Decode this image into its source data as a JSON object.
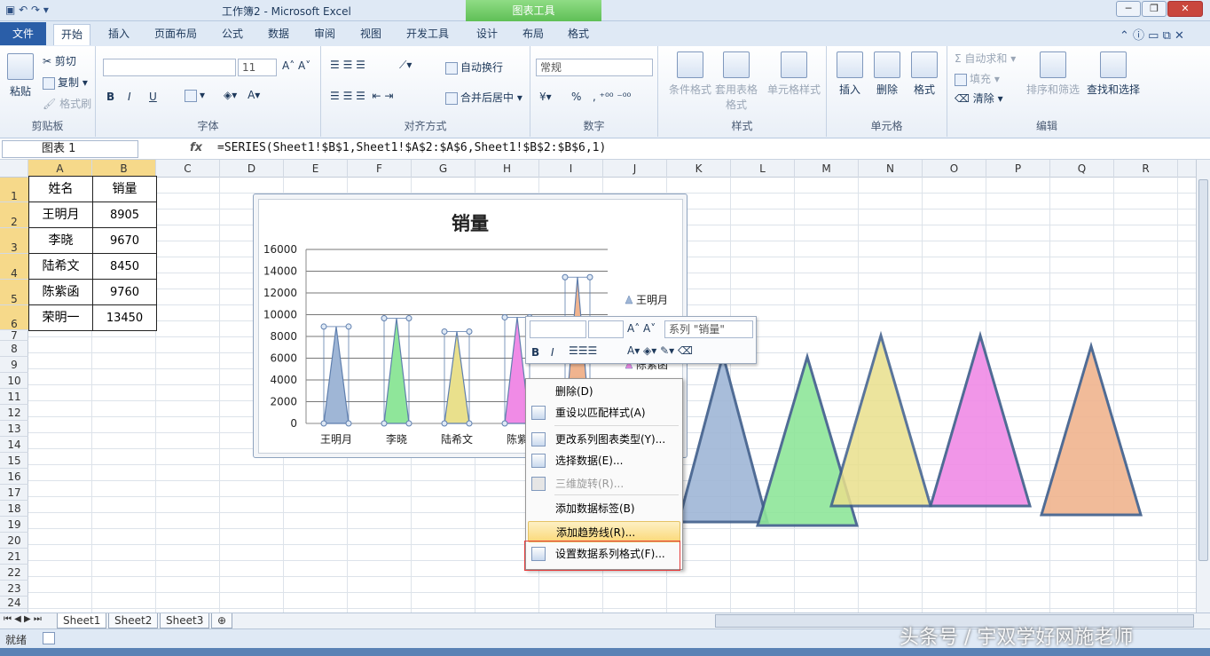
{
  "window": {
    "title": "工作簿2 - Microsoft Excel",
    "chart_tools": "图表工具",
    "minimize": "─",
    "restore": "❐",
    "close": "✕"
  },
  "tabs": [
    "文件",
    "开始",
    "插入",
    "页面布局",
    "公式",
    "数据",
    "审阅",
    "视图",
    "开发工具",
    "设计",
    "布局",
    "格式"
  ],
  "ribbon": {
    "clipboard": {
      "label": "剪贴板",
      "paste": "粘贴",
      "cut": "剪切",
      "copy": "复制",
      "format_painter": "格式刷"
    },
    "font": {
      "label": "字体",
      "size": "11",
      "bold": "B",
      "italic": "I",
      "underline": "U"
    },
    "alignment": {
      "label": "对齐方式",
      "wrap": "自动换行",
      "merge": "合并后居中"
    },
    "number": {
      "label": "数字",
      "format": "常规",
      "percent": "%"
    },
    "styles": {
      "label": "样式",
      "conditional": "条件格式",
      "table": "套用表格格式",
      "cell": "单元格样式"
    },
    "cells": {
      "label": "单元格",
      "insert": "插入",
      "delete": "删除",
      "format": "格式"
    },
    "editing": {
      "label": "编辑",
      "autosum": "自动求和",
      "fill": "填充",
      "clear": "清除",
      "sort": "排序和筛选",
      "find": "查找和选择"
    }
  },
  "formula_bar": {
    "name_box": "图表 1",
    "fx": "fx",
    "formula": "=SERIES(Sheet1!$B$1,Sheet1!$A$2:$A$6,Sheet1!$B$2:$B$6,1)"
  },
  "columns": [
    "A",
    "B",
    "C",
    "D",
    "E",
    "F",
    "G",
    "H",
    "I",
    "J",
    "K",
    "L",
    "M",
    "N",
    "O",
    "P",
    "Q",
    "R"
  ],
  "rows": [
    "1",
    "2",
    "3",
    "4",
    "5",
    "6",
    "7",
    "8",
    "9",
    "10",
    "11",
    "12",
    "13",
    "14",
    "15",
    "16",
    "17",
    "18",
    "19",
    "20",
    "21",
    "22",
    "23",
    "24"
  ],
  "table": {
    "headers": [
      "姓名",
      "销量"
    ],
    "rows": [
      [
        "王明月",
        "8905"
      ],
      [
        "李晓",
        "9670"
      ],
      [
        "陆希文",
        "8450"
      ],
      [
        "陈紫函",
        "9760"
      ],
      [
        "荣明一",
        "13450"
      ]
    ]
  },
  "chart_data": {
    "type": "bar",
    "title": "销量",
    "categories": [
      "王明月",
      "李晓",
      "陆希文",
      "陈紫"
    ],
    "values": [
      8905,
      9670,
      8450,
      9760,
      13450
    ],
    "ylim": [
      0,
      16000
    ],
    "yticks": [
      "0",
      "2000",
      "4000",
      "6000",
      "8000",
      "10000",
      "12000",
      "14000",
      "16000"
    ],
    "legend": [
      "王明月",
      "陈紫函"
    ],
    "colors": [
      "#9fb6d6",
      "#8fe69a",
      "#e9e08c",
      "#f08be6",
      "#f0b48f"
    ],
    "grid": true
  },
  "mini_toolbar": {
    "series_selector": "系列 \"销量\"",
    "bold": "B",
    "italic": "I"
  },
  "context_menu": [
    {
      "label": "删除(D)",
      "disabled": false
    },
    {
      "label": "重设以匹配样式(A)",
      "disabled": false
    },
    {
      "label": "更改系列图表类型(Y)...",
      "disabled": false
    },
    {
      "label": "选择数据(E)...",
      "disabled": false
    },
    {
      "label": "三维旋转(R)...",
      "disabled": true
    },
    {
      "label": "添加数据标签(B)",
      "disabled": false
    },
    {
      "label": "添加趋势线(R)...",
      "disabled": false,
      "highlighted": true
    },
    {
      "label": "设置数据系列格式(F)...",
      "disabled": false
    }
  ],
  "sheets": [
    "Sheet1",
    "Sheet2",
    "Sheet3"
  ],
  "status": "就绪",
  "watermark": "头条号 / 宇双学好网施老师"
}
